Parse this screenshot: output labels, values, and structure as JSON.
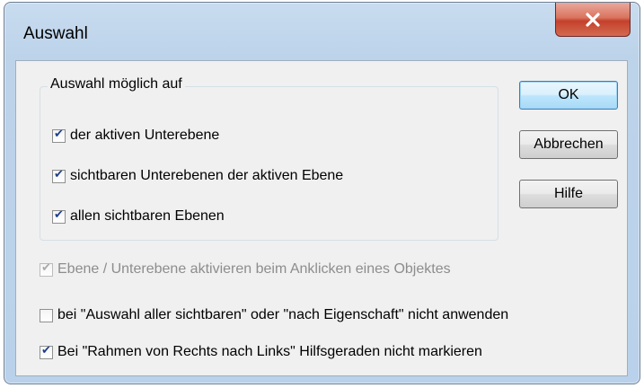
{
  "dialog": {
    "title": "Auswahl",
    "close_icon": "close-icon"
  },
  "group": {
    "legend": "Auswahl möglich auf",
    "options": [
      {
        "label": "der aktiven Unterebene",
        "checked": true
      },
      {
        "label": "sichtbaren Unterebenen der aktiven Ebene",
        "checked": true
      },
      {
        "label": "allen sichtbaren Ebenen",
        "checked": true
      }
    ]
  },
  "options": [
    {
      "label": "Ebene / Unterebene aktivieren beim Anklicken eines Objektes",
      "checked": true,
      "enabled": false
    },
    {
      "label": "bei \"Auswahl aller sichtbaren\" oder \"nach Eigenschaft\" nicht anwenden",
      "checked": false,
      "enabled": true
    },
    {
      "label": "Bei \"Rahmen von Rechts nach Links\" Hilfsgeraden nicht markieren",
      "checked": true,
      "enabled": true
    }
  ],
  "buttons": {
    "ok": "OK",
    "cancel": "Abbrechen",
    "help": "Hilfe"
  },
  "colors": {
    "close_button": "#c4402b",
    "check_mark": "#1c3f8c",
    "default_button_border": "#3c7fb1"
  }
}
